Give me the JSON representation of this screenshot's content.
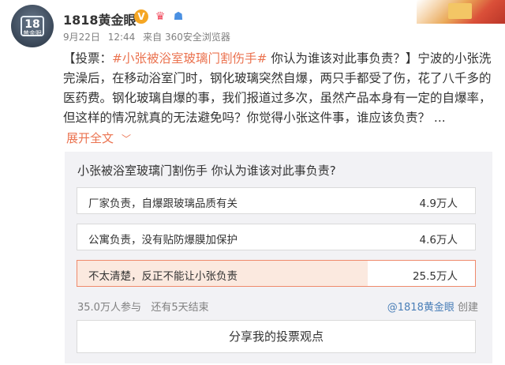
{
  "header": {
    "avatar_text": "18",
    "avatar_subtext": "黄金眼",
    "username": "1818黄金眼",
    "verified_icon": "v-verified-icon",
    "date": "9月22日",
    "time": "12:44",
    "source": "来自 360安全浏览器"
  },
  "post": {
    "prefix": "【投票：",
    "topic": "#小张被浴室玻璃门割伤手#",
    "body": " 你认为谁该对此事负责？】宁波的小张洗完澡后，在移动浴室门时，钢化玻璃突然自爆，两只手都受了伤，花了八千多的医药费。钢化玻璃自爆的事，我们报道过多次，虽然产品本身有一定的自爆率，但这样的情况就真的无法避免吗？你觉得小张这件事，谁应该负责？ ...",
    "expand_label": "展开全文",
    "expand_icon": "chevron-down-icon"
  },
  "vote": {
    "question": "小张被浴室玻璃门割伤手 你认为谁该对此事负责?",
    "options": [
      {
        "label": "厂家负责，自爆跟玻璃品质有关",
        "count": "4.9万人",
        "share": 0.14
      },
      {
        "label": "公寓负责，没有贴防爆膜加保护",
        "count": "4.6万人",
        "share": 0.13
      },
      {
        "label": "不太清楚，反正不能让小张负责",
        "count": "25.5万人",
        "share": 0.73
      }
    ],
    "participants": "35.0万人参与",
    "remaining": "还有5天结束",
    "owner": "@1818黄金眼",
    "owner_suffix": "创建",
    "share_button": "分享我的投票观点"
  },
  "colors": {
    "accent": "#eb7350",
    "link": "#4a7fb8",
    "card_bg": "#f2f2f5"
  }
}
